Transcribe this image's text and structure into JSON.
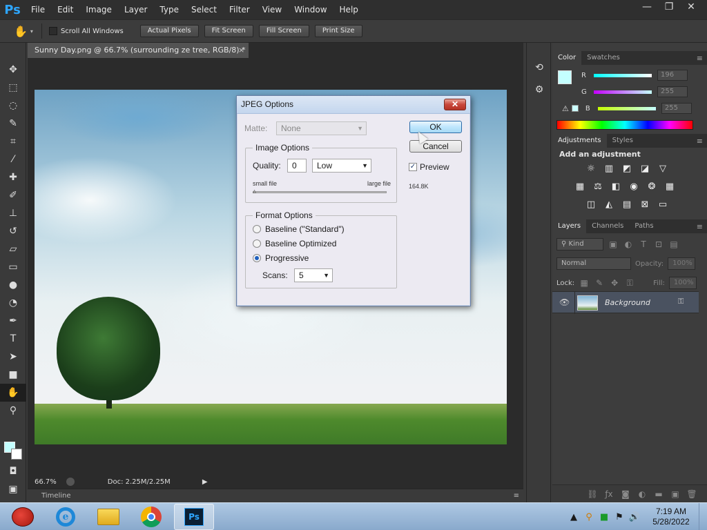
{
  "app": {
    "logo": "Ps"
  },
  "menu": [
    "File",
    "Edit",
    "Image",
    "Layer",
    "Type",
    "Select",
    "Filter",
    "View",
    "Window",
    "Help"
  ],
  "window_controls": {
    "minimize": "—",
    "restore": "❐",
    "close": "✕"
  },
  "options": {
    "scroll_all_windows": "Scroll All Windows",
    "actual_pixels": "Actual Pixels",
    "fit_screen": "Fit Screen",
    "fill_screen": "Fill Screen",
    "print_size": "Print Size"
  },
  "document": {
    "tab_title": "Sunny Day.png @ 66.7% (surrounding ze tree, RGB/8) *",
    "close_glyph": "×",
    "zoom": "66.7%",
    "doc_size": "Doc: 2.25M/2.25M"
  },
  "timeline": {
    "label": "Timeline"
  },
  "color_panel": {
    "tabs": [
      "Color",
      "Swatches"
    ],
    "r_label": "R",
    "g_label": "G",
    "b_label": "B",
    "r_value": "196",
    "g_value": "255",
    "b_value": "255",
    "fg_color": "#c4ffff"
  },
  "adjustments_panel": {
    "tabs": [
      "Adjustments",
      "Styles"
    ],
    "heading": "Add an adjustment"
  },
  "layers_panel": {
    "tabs": [
      "Layers",
      "Channels",
      "Paths"
    ],
    "filter_kind": "Kind",
    "blend_mode": "Normal",
    "opacity_label": "Opacity:",
    "opacity_value": "100%",
    "lock_label": "Lock:",
    "fill_label": "Fill:",
    "fill_value": "100%",
    "layer_name": "Background"
  },
  "dialog": {
    "title": "JPEG Options",
    "close_glyph": "✕",
    "matte_label": "Matte:",
    "matte_value": "None",
    "image_options_label": "Image Options",
    "quality_label": "Quality:",
    "quality_value": "0",
    "quality_preset": "Low",
    "small_file": "small file",
    "large_file": "large file",
    "format_options_label": "Format Options",
    "baseline_standard": "Baseline (\"Standard\")",
    "baseline_optimized": "Baseline Optimized",
    "progressive": "Progressive",
    "selected_format": "Progressive",
    "scans_label": "Scans:",
    "scans_value": "5",
    "ok": "OK",
    "cancel": "Cancel",
    "preview_label": "Preview",
    "preview_checked": true,
    "file_size": "164.8K"
  },
  "clock": {
    "time": "7:19 AM",
    "date": "5/28/2022"
  },
  "taskbar_apps": [
    "angry-birds",
    "internet-explorer",
    "file-explorer",
    "chrome",
    "photoshop"
  ]
}
